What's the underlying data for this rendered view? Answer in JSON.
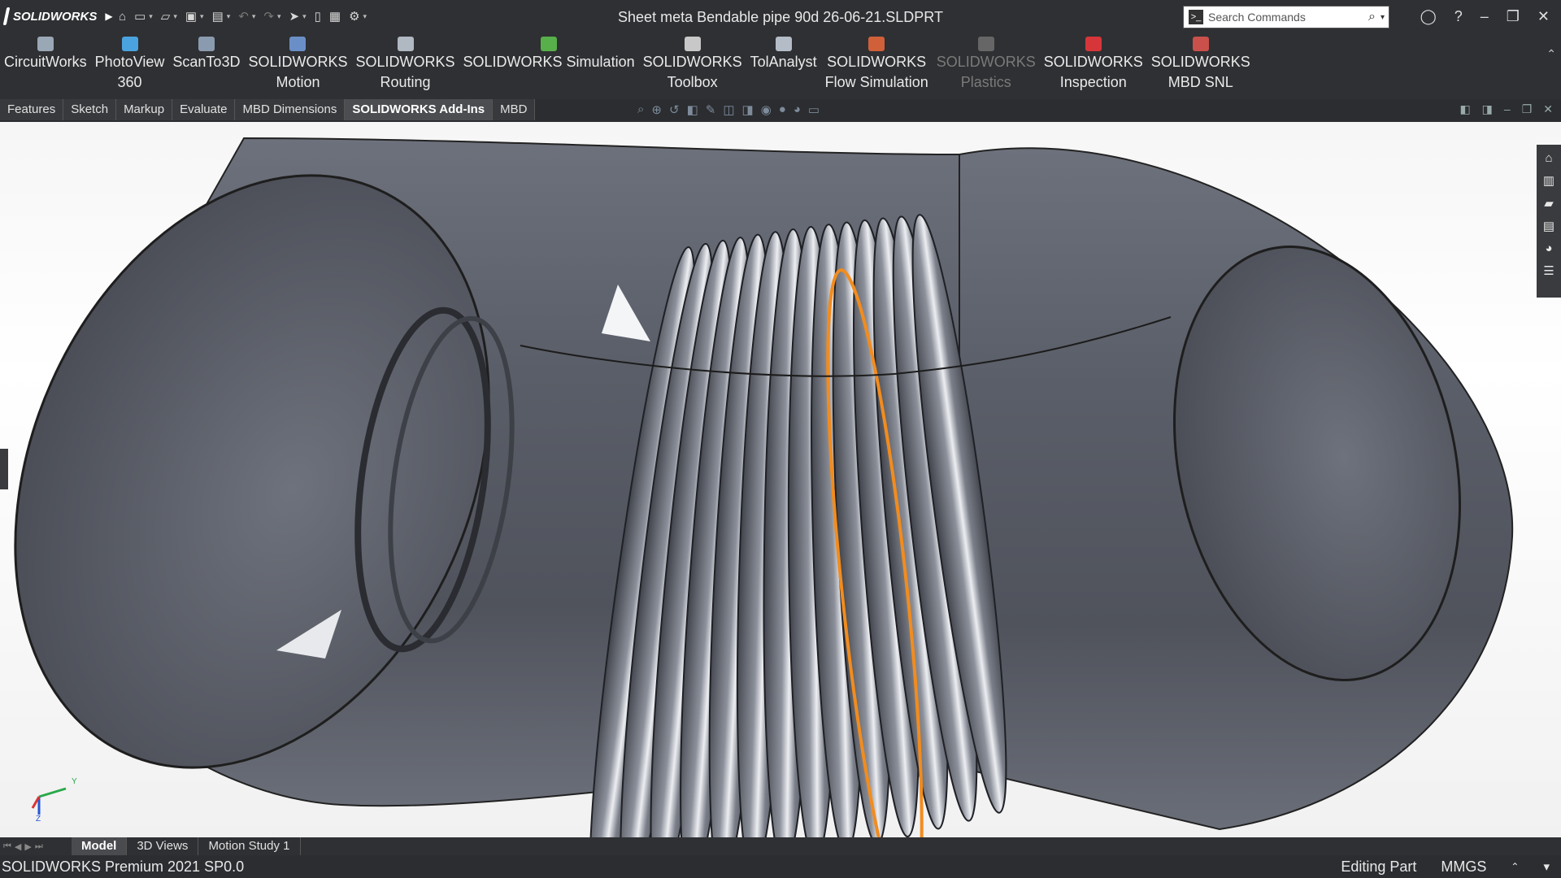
{
  "app": {
    "brand": "SOLIDWORKS",
    "document_title": "Sheet meta Bendable pipe 90d  26-06-21.SLDPRT"
  },
  "search": {
    "placeholder": "Search Commands"
  },
  "ribbon": {
    "items": [
      {
        "line1": "CircuitWorks",
        "line2": "",
        "icon": "circuitworks-icon",
        "color": "#9aa7b5",
        "enabled": true
      },
      {
        "line1": "PhotoView",
        "line2": "360",
        "icon": "photoview-icon",
        "color": "#4aa3df",
        "enabled": true
      },
      {
        "line1": "ScanTo3D",
        "line2": "",
        "icon": "scanto3d-icon",
        "color": "#8a9bb0",
        "enabled": true
      },
      {
        "line1": "SOLIDWORKS",
        "line2": "Motion",
        "icon": "motion-icon",
        "color": "#6a8fc7",
        "enabled": true
      },
      {
        "line1": "SOLIDWORKS",
        "line2": "Routing",
        "icon": "routing-icon",
        "color": "#b0b8c2",
        "enabled": true
      },
      {
        "line1": "SOLIDWORKS Simulation",
        "line2": "",
        "icon": "simulation-icon",
        "color": "#57b04a",
        "enabled": true
      },
      {
        "line1": "SOLIDWORKS",
        "line2": "Toolbox",
        "icon": "toolbox-icon",
        "color": "#c8c8c8",
        "enabled": true
      },
      {
        "line1": "TolAnalyst",
        "line2": "",
        "icon": "tolanalyst-icon",
        "color": "#b4bcc8",
        "enabled": true
      },
      {
        "line1": "SOLIDWORKS",
        "line2": "Flow Simulation",
        "icon": "flow-simulation-icon",
        "color": "#d0603a",
        "enabled": true
      },
      {
        "line1": "SOLIDWORKS",
        "line2": "Plastics",
        "icon": "plastics-icon",
        "color": "#666",
        "enabled": false
      },
      {
        "line1": "SOLIDWORKS",
        "line2": "Inspection",
        "icon": "inspection-icon",
        "color": "#d6363a",
        "enabled": true
      },
      {
        "line1": "SOLIDWORKS",
        "line2": "MBD SNL",
        "icon": "mbd-snl-icon",
        "color": "#c9504b",
        "enabled": true
      }
    ]
  },
  "tabs": [
    {
      "label": "Features",
      "active": false
    },
    {
      "label": "Sketch",
      "active": false
    },
    {
      "label": "Markup",
      "active": false
    },
    {
      "label": "Evaluate",
      "active": false
    },
    {
      "label": "MBD Dimensions",
      "active": false
    },
    {
      "label": "SOLIDWORKS Add-Ins",
      "active": true
    },
    {
      "label": "MBD",
      "active": false
    }
  ],
  "bottom_tabs": [
    {
      "label": "Model",
      "active": true
    },
    {
      "label": "3D Views",
      "active": false
    },
    {
      "label": "Motion Study 1",
      "active": false
    }
  ],
  "status": {
    "product": "SOLIDWORKS Premium 2021 SP0.0",
    "mode": "Editing Part",
    "units": "MMGS"
  },
  "triad": {
    "x": "X",
    "y": "Y",
    "z": "Z"
  },
  "colors": {
    "pipe": "#5b5f69",
    "highlight": "#f28c1e",
    "background": "#ffffff",
    "chrome": "#2f3033"
  }
}
